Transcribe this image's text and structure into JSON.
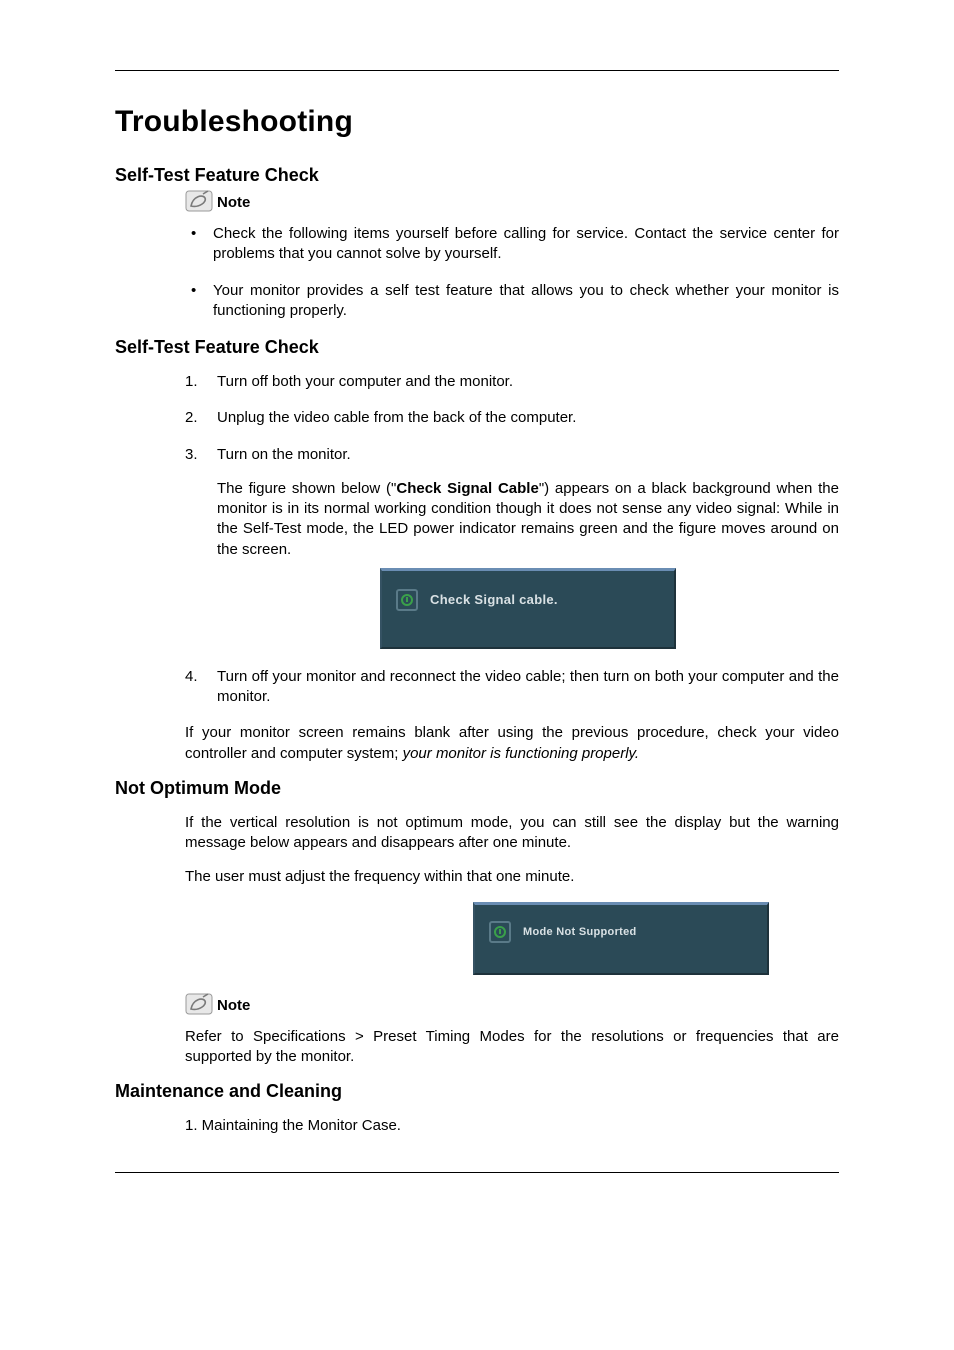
{
  "title": "Troubleshooting",
  "sections": {
    "stfc1": {
      "heading": "Self-Test Feature Check",
      "note_label": "Note",
      "bullets": [
        "Check the following items yourself before calling for service. Contact the service center for problems that you cannot solve by yourself.",
        "Your monitor provides a self test feature that allows you to check whether your monitor is functioning properly."
      ]
    },
    "stfc2": {
      "heading": "Self-Test Feature Check",
      "steps": {
        "s1": {
          "num": "1.",
          "text": "Turn off both your computer and the monitor."
        },
        "s2": {
          "num": "2.",
          "text": "Unplug the video cable from the back of the computer."
        },
        "s3": {
          "num": "3.",
          "text": "Turn on the monitor.",
          "sub_pre": "The figure shown below (\"",
          "sub_bold": "Check Signal Cable",
          "sub_post": "\") appears on a black background when the monitor is in its normal working condition though it does not sense any video signal: While in the Self-Test mode, the LED power indicator remains green and the figure moves around on the screen."
        },
        "s4": {
          "num": "4.",
          "text": "Turn off your monitor and reconnect the video cable; then turn on both your computer and the monitor."
        }
      },
      "osd_text": "Check Signal cable.",
      "after_pre": "If your monitor screen remains blank after using the previous procedure, check your video controller and computer system; ",
      "after_italic": "your monitor is functioning properly."
    },
    "nom": {
      "heading": "Not Optimum Mode",
      "p1": "If the vertical resolution is not optimum mode, you can still see the display but the warning message below appears and disappears after one minute.",
      "p2": "The user must adjust the frequency within that one minute.",
      "osd_text": "Mode Not Supported",
      "note_label": "Note",
      "note_body": "Refer to Specifications > Preset Timing Modes for the resolutions or frequencies that are supported by the monitor."
    },
    "mc": {
      "heading": "Maintenance and Cleaning",
      "item1": "1. Maintaining the Monitor Case."
    }
  }
}
